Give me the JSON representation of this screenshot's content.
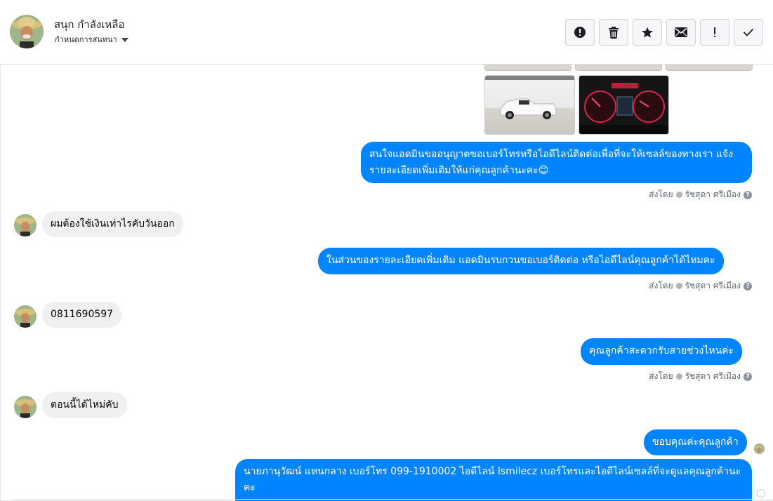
{
  "header": {
    "name": "สนุก กำลังเหลือ",
    "assign_label": "กำหนดการสนทนา",
    "toolbar": [
      {
        "name": "spam-button",
        "icon": "alert-circle-icon"
      },
      {
        "name": "delete-button",
        "icon": "trash-icon"
      },
      {
        "name": "star-button",
        "icon": "star-icon"
      },
      {
        "name": "mark-unread-button",
        "icon": "envelope-icon"
      },
      {
        "name": "follow-up-button",
        "icon": "exclamation-icon"
      },
      {
        "name": "mark-done-button",
        "icon": "check-icon"
      }
    ]
  },
  "thread": {
    "msg1": "สนใจแอดมินขออนุญาตขอเบอร์โทรหรือไอดีไลน์ติดต่อเพื่อที่จะให้เซลล์ของทางเรา แจ้งรายละเอียดเพิ่มเติมให้แก่คุณลูกค้านะคะ😊",
    "msg2": "ผมต้องใช้เงินเท่าไรคับวันออก",
    "msg3": "ในส่วนของรายละเอียดเพิ่มเติม แอดมินรบกวนขอเบอร์ติดต่อ หรือไอดีไลน์คุณลูกค้าได้ไหมคะ",
    "msg4": "0811690597",
    "msg5": "คุณลูกค้าสะดวกรับสายช่วงไหนค่ะ",
    "msg6": "ตอนนี้ได้ไหม่คับ",
    "msg7": "ขอบคุณค่ะคุณลูกค้า",
    "msg8": "นายภานุวัฒน์ แหนกลาง เบอร์โทร 099-1910002 ไอดีไลน์ lsmilecz   เบอร์โทรและไอดีไลน์เซลล์ที่จะดูแลคุณลูกค้านะคะ",
    "sent_by_prefix": "ส่งโดย",
    "sent_by_name": "รัชสุดา ศรีเมือง"
  },
  "colors": {
    "outgoing": "#0084ff",
    "incoming": "#f0f0f0"
  }
}
